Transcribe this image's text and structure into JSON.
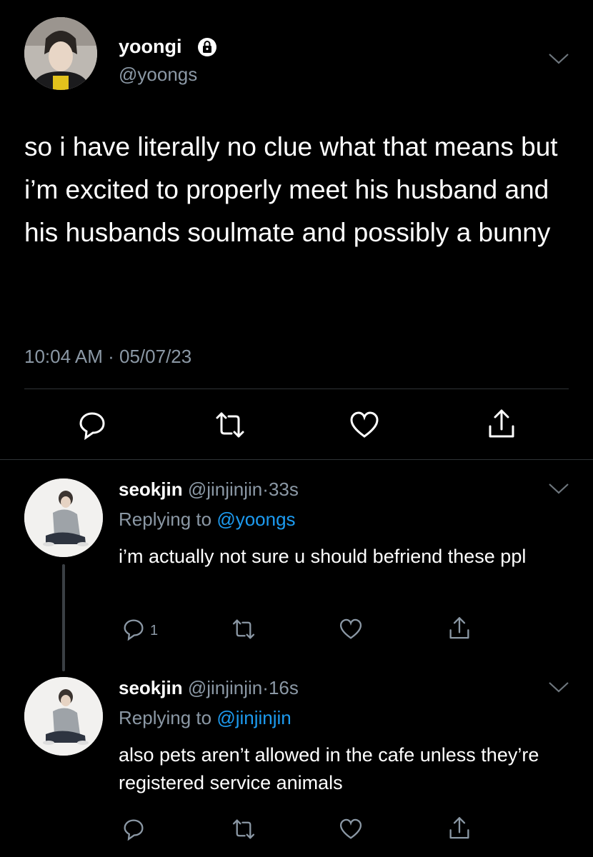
{
  "main_tweet": {
    "name": "yoongi",
    "handle": "@yoongs",
    "text": "so i have literally no clue what that means but i’m excited to properly meet his husband and his husbands soulmate and possibly a bunny",
    "time": "10:04 AM",
    "separator": "·",
    "date": "05/07/23",
    "icons": [
      "lock-icon",
      "chevron-down-icon",
      "reply-icon",
      "retweet-icon",
      "like-icon",
      "share-icon"
    ]
  },
  "replies": [
    {
      "name": "seokjin",
      "handle": "@jinjinjin",
      "separator": "·",
      "age": "33s",
      "replying_prefix": "Replying to",
      "replying_to": "@yoongs",
      "text": "i’m actually not sure u should befriend these ppl",
      "reply_count": "1"
    },
    {
      "name": "seokjin",
      "handle": "@jinjinjin",
      "separator": "·",
      "age": "16s",
      "replying_prefix": "Replying to",
      "replying_to": "@jinjinjin",
      "text": "also pets aren’t allowed in the cafe unless they’re registered service animals",
      "reply_count": ""
    }
  ],
  "colors": {
    "background": "#000000",
    "text": "#ffffff",
    "secondary": "#8b98a5",
    "link": "#1d9bf0",
    "divider": "#2f3336"
  }
}
